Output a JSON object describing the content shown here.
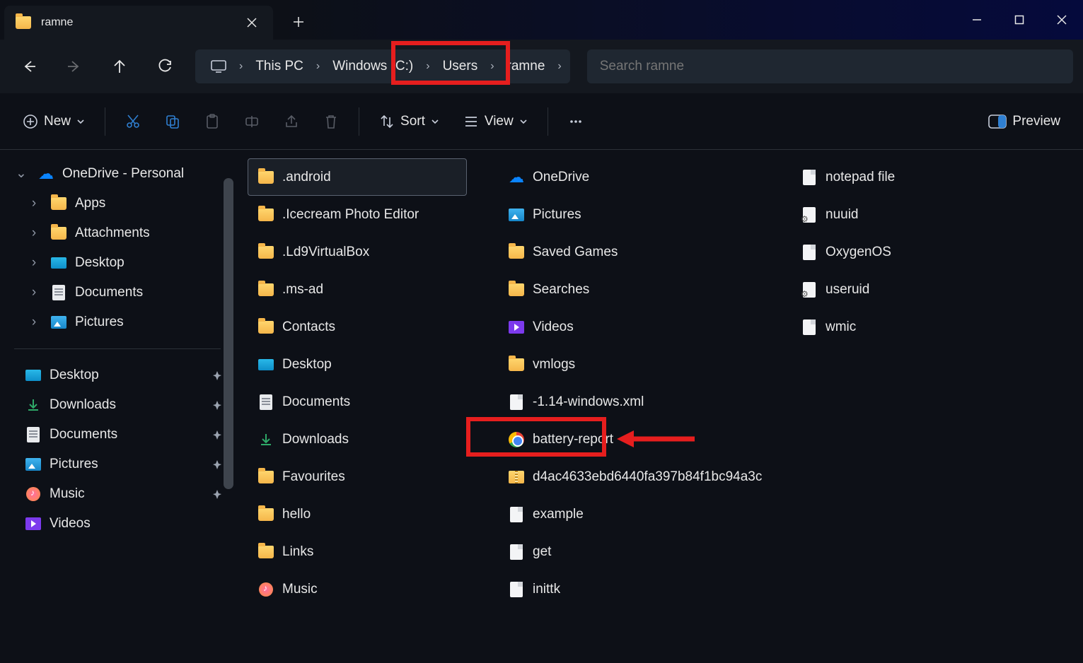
{
  "tab": {
    "title": "ramne"
  },
  "breadcrumbs": [
    "This PC",
    "Windows (C:)",
    "Users",
    "ramne"
  ],
  "search": {
    "placeholder": "Search ramne"
  },
  "toolbar": {
    "new": "New",
    "sort": "Sort",
    "view": "View",
    "preview": "Preview"
  },
  "sidebar": {
    "top": {
      "label": "OneDrive - Personal"
    },
    "children": [
      {
        "label": "Apps",
        "icon": "folder"
      },
      {
        "label": "Attachments",
        "icon": "folder"
      },
      {
        "label": "Desktop",
        "icon": "desktop"
      },
      {
        "label": "Documents",
        "icon": "docpage"
      },
      {
        "label": "Pictures",
        "icon": "pic"
      }
    ],
    "quick": [
      {
        "label": "Desktop",
        "icon": "desktop",
        "pinned": true
      },
      {
        "label": "Downloads",
        "icon": "dl",
        "pinned": true
      },
      {
        "label": "Documents",
        "icon": "docpage",
        "pinned": true
      },
      {
        "label": "Pictures",
        "icon": "pic",
        "pinned": true
      },
      {
        "label": "Music",
        "icon": "music",
        "pinned": true
      },
      {
        "label": "Videos",
        "icon": "video",
        "pinned": false
      }
    ]
  },
  "files": {
    "col1": [
      {
        "label": ".android",
        "icon": "folder",
        "selected": true
      },
      {
        "label": ".Icecream Photo Editor",
        "icon": "folder"
      },
      {
        "label": ".Ld9VirtualBox",
        "icon": "folder"
      },
      {
        "label": ".ms-ad",
        "icon": "folder"
      },
      {
        "label": "Contacts",
        "icon": "folder"
      },
      {
        "label": "Desktop",
        "icon": "desktop"
      },
      {
        "label": "Documents",
        "icon": "docpage"
      },
      {
        "label": "Downloads",
        "icon": "dl"
      },
      {
        "label": "Favourites",
        "icon": "folder"
      },
      {
        "label": "hello",
        "icon": "folder"
      },
      {
        "label": "Links",
        "icon": "folder"
      },
      {
        "label": "Music",
        "icon": "music"
      }
    ],
    "col2": [
      {
        "label": "OneDrive",
        "icon": "cloud"
      },
      {
        "label": "Pictures",
        "icon": "pic"
      },
      {
        "label": "Saved Games",
        "icon": "folder"
      },
      {
        "label": "Searches",
        "icon": "folder"
      },
      {
        "label": "Videos",
        "icon": "video"
      },
      {
        "label": "vmlogs",
        "icon": "folder"
      },
      {
        "label": "-1.14-windows.xml",
        "icon": "file"
      },
      {
        "label": "battery-report",
        "icon": "chrome",
        "highlight": true
      },
      {
        "label": "d4ac4633ebd6440fa397b84f1bc94a3c",
        "icon": "zip"
      },
      {
        "label": "example",
        "icon": "file"
      },
      {
        "label": "get",
        "icon": "file"
      },
      {
        "label": "inittk",
        "icon": "file"
      }
    ],
    "col3": [
      {
        "label": "notepad file",
        "icon": "file"
      },
      {
        "label": "nuuid",
        "icon": "gear"
      },
      {
        "label": "OxygenOS",
        "icon": "file"
      },
      {
        "label": "useruid",
        "icon": "gear"
      },
      {
        "label": "wmic",
        "icon": "file"
      }
    ]
  }
}
